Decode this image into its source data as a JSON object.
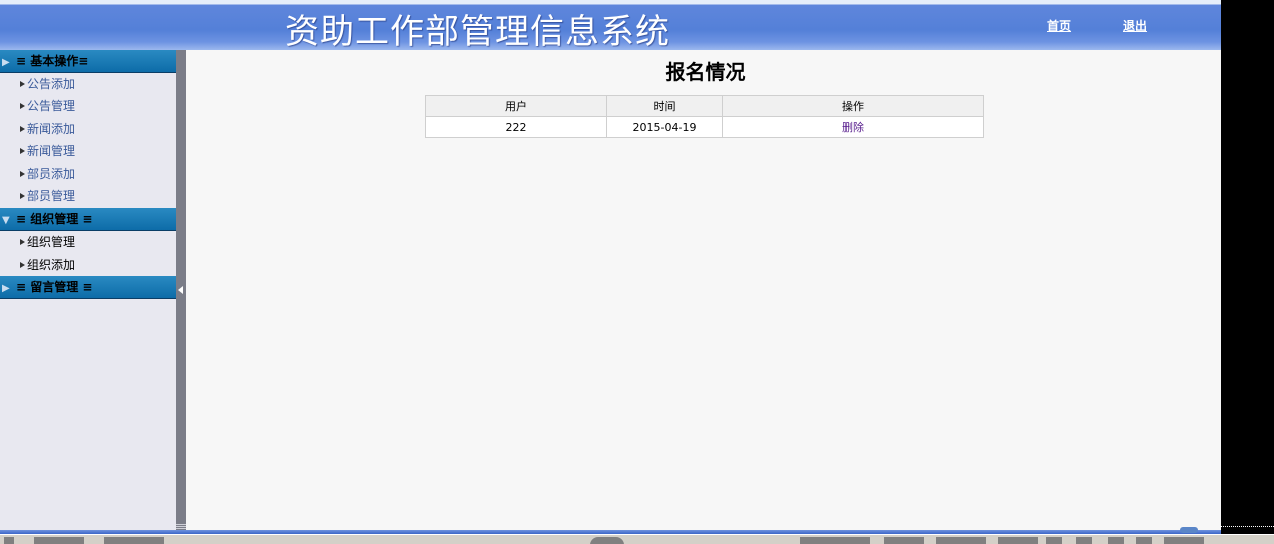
{
  "header": {
    "title": "资助工作部管理信息系统",
    "links": {
      "home": "首页",
      "logout": "退出"
    }
  },
  "sidebar": {
    "groups": [
      {
        "label": "≡ 基本操作≡",
        "icon": "collapsed-folder-icon",
        "items": [
          "公告添加",
          "公告管理",
          "新闻添加",
          "新闻管理",
          "部员添加",
          "部员管理"
        ]
      },
      {
        "label": "≡ 组织管理 ≡",
        "icon": "expanded-folder-icon",
        "items": [
          "组织管理",
          "组织添加"
        ]
      },
      {
        "label": "≡ 留言管理 ≡",
        "icon": "collapsed-folder-icon",
        "items": []
      }
    ]
  },
  "main": {
    "title": "报名情况",
    "table": {
      "columns": [
        "用户",
        "时间",
        "操作"
      ],
      "rows": [
        {
          "user": "222",
          "time": "2015-04-19",
          "action": "删除"
        }
      ]
    }
  },
  "colors": {
    "header_blue": "#5480d8",
    "sidebar_group": "#0d6ca8",
    "sidebar_bg": "#e8e8f0",
    "splitter": "#7b7d88",
    "visited_link": "#551a8b"
  }
}
